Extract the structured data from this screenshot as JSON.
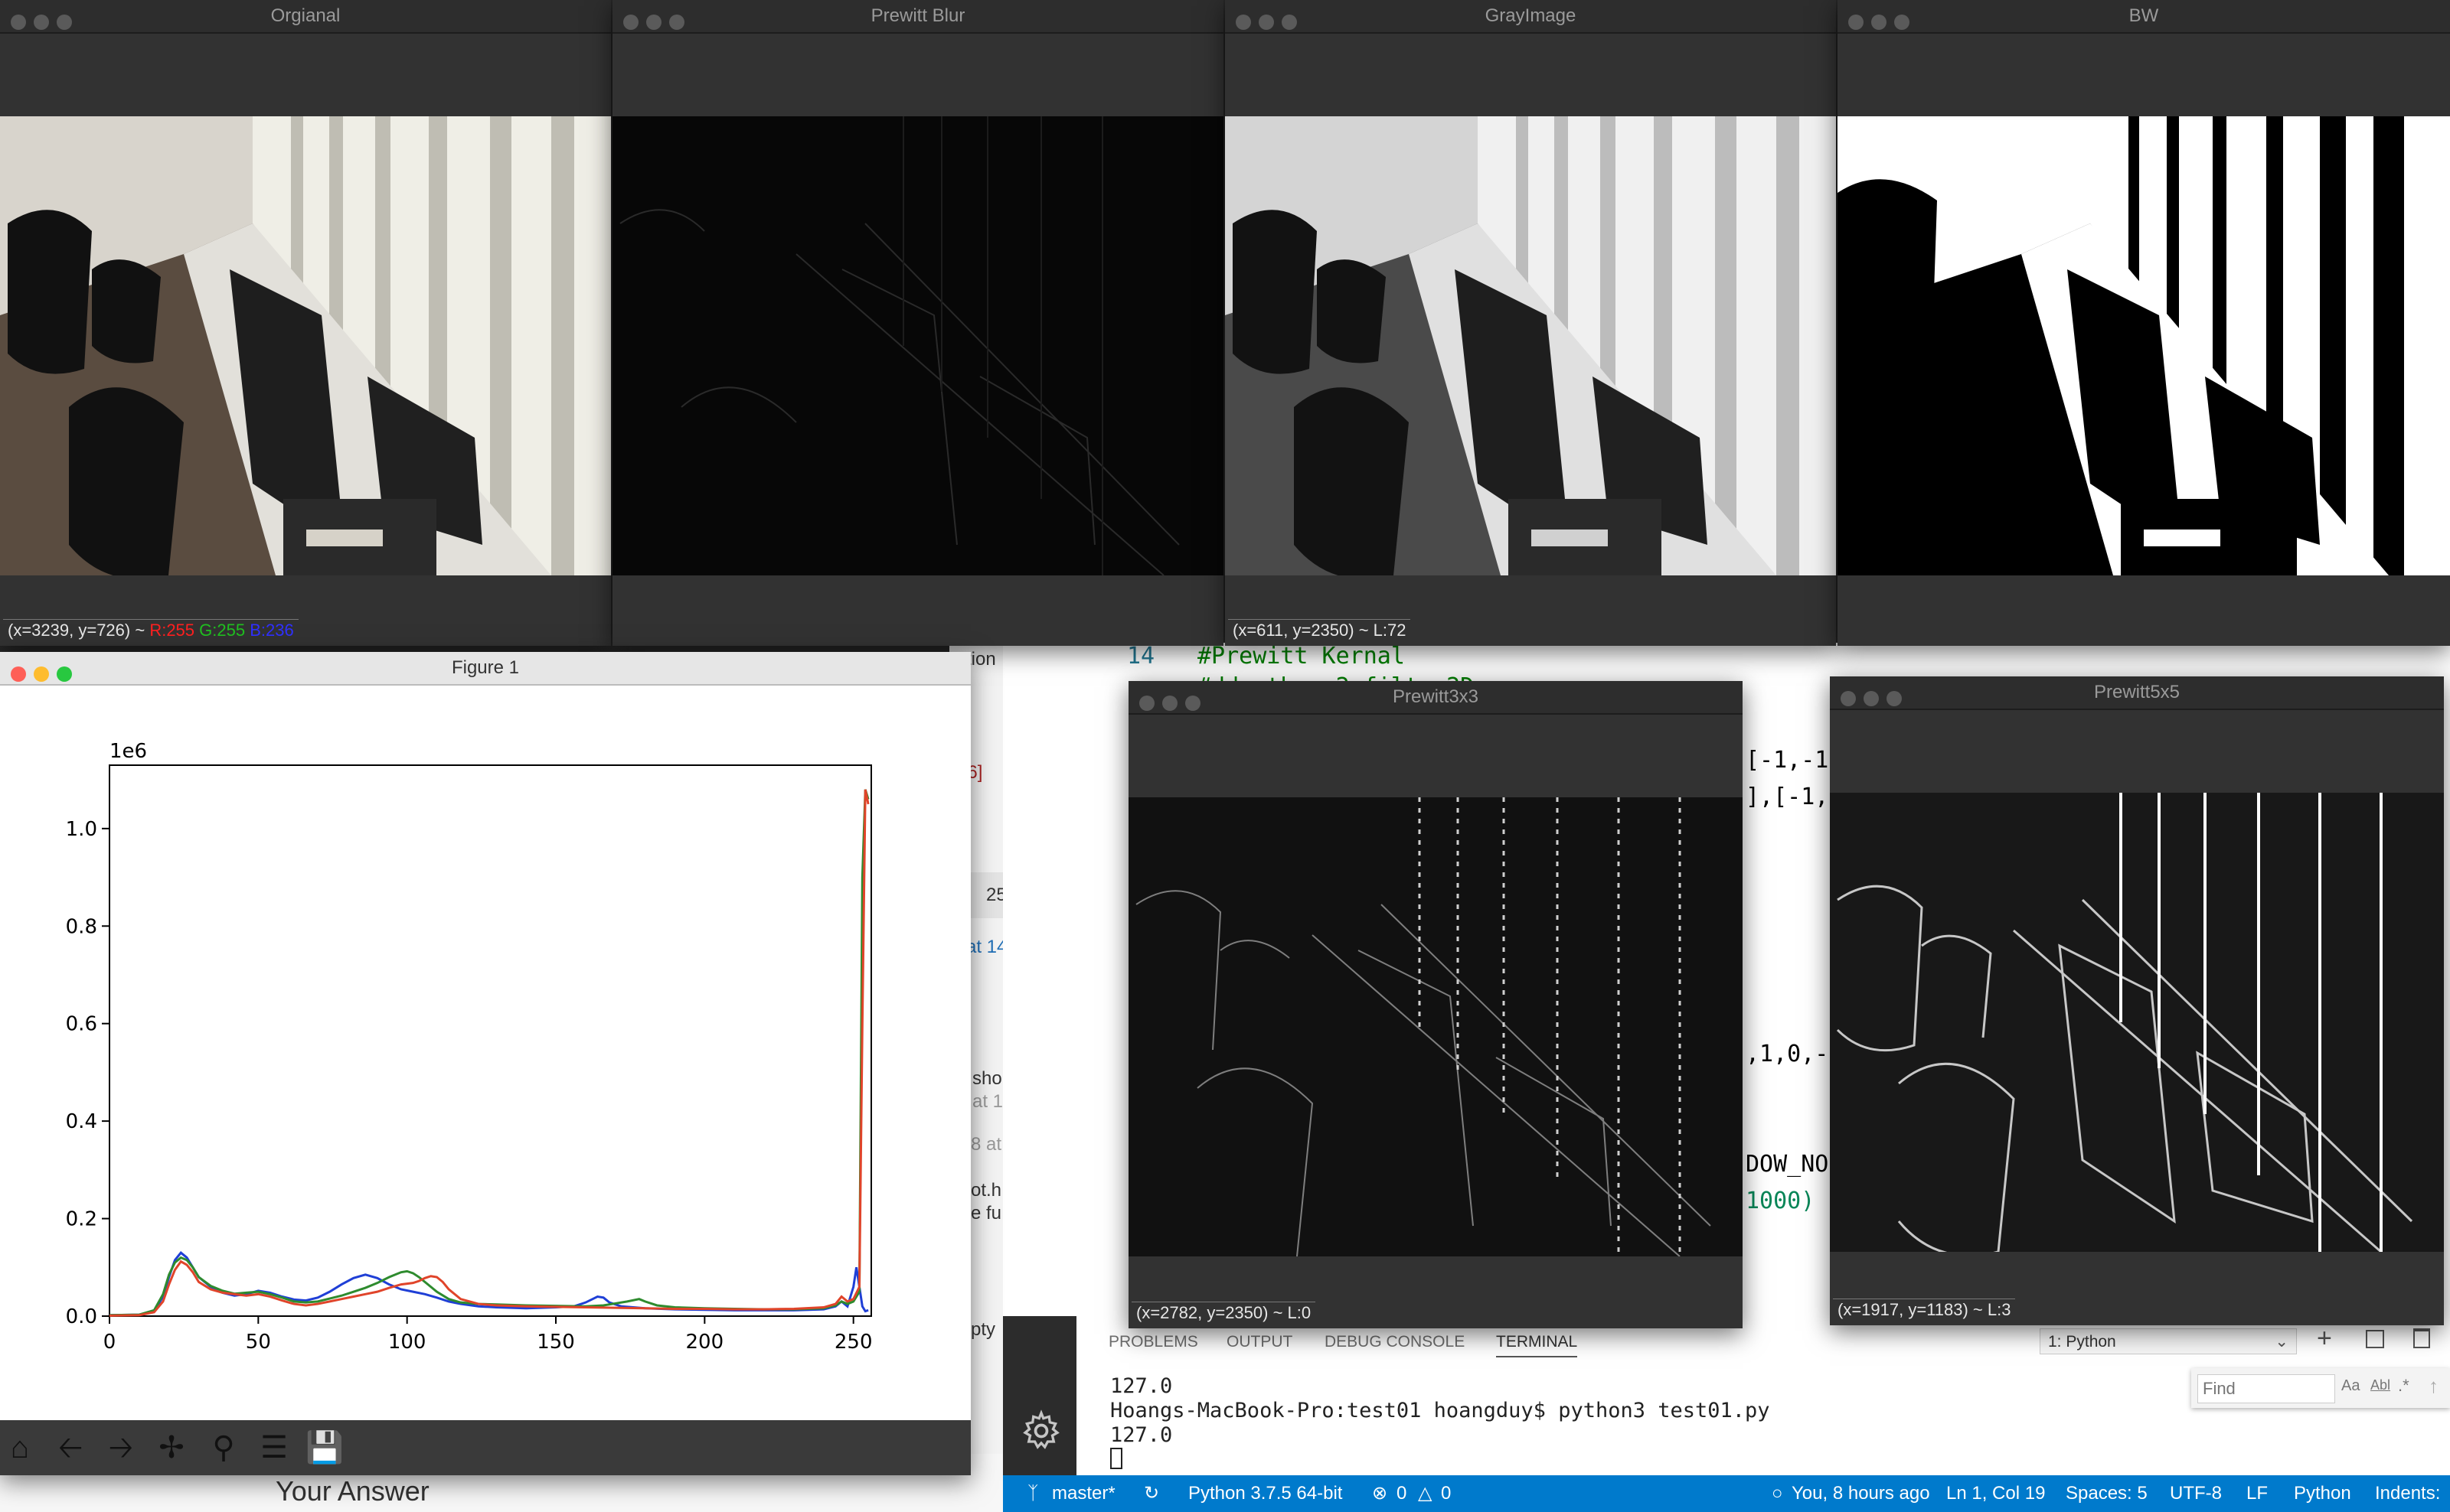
{
  "windows": {
    "original": {
      "title": "Orgianal",
      "coord": "(x=3239, y=726) ~",
      "r": "R:255",
      "g": "G:255",
      "b": "B:236"
    },
    "prewitt_blur": {
      "title": "Prewitt Blur"
    },
    "gray": {
      "title": "GrayImage",
      "coord": "(x=611, y=2350) ~ L:72"
    },
    "bw": {
      "title": "BW"
    },
    "prewitt3": {
      "title": "Prewitt3x3",
      "coord": "(x=2782, y=2350) ~ L:0"
    },
    "prewitt5": {
      "title": "Prewitt5x5",
      "coord": "(x=1917, y=1183) ~ L:3"
    }
  },
  "figure": {
    "title": "Figure 1",
    "toolbar": [
      "home-icon",
      "back-icon",
      "forward-icon",
      "pan-icon",
      "zoom-icon",
      "configure-icon",
      "save-icon"
    ]
  },
  "chart_data": {
    "type": "line",
    "scale_label": "1e6",
    "xlim": [
      0,
      256
    ],
    "ylim": [
      0,
      1.13
    ],
    "xticks": [
      0,
      50,
      100,
      150,
      200,
      250
    ],
    "yticks": [
      "0.0",
      "0.2",
      "0.4",
      "0.6",
      "0.8",
      "1.0"
    ],
    "ytick_values": [
      0,
      0.2,
      0.4,
      0.6,
      0.8,
      1.0
    ],
    "series": [
      {
        "color": "#1f3fd6",
        "x": [
          0,
          10,
          15,
          18,
          20,
          22,
          24,
          26,
          28,
          30,
          34,
          38,
          42,
          46,
          50,
          54,
          58,
          62,
          66,
          70,
          74,
          78,
          82,
          86,
          90,
          94,
          98,
          102,
          106,
          110,
          114,
          118,
          124,
          130,
          140,
          150,
          156,
          160,
          164,
          166,
          168,
          172,
          180,
          190,
          200,
          210,
          220,
          230,
          240,
          244,
          246,
          248,
          250,
          251,
          252,
          253,
          254,
          255
        ],
        "y": [
          0.002,
          0.003,
          0.01,
          0.04,
          0.08,
          0.115,
          0.13,
          0.12,
          0.1,
          0.08,
          0.06,
          0.048,
          0.042,
          0.045,
          0.052,
          0.048,
          0.04,
          0.034,
          0.032,
          0.038,
          0.05,
          0.065,
          0.078,
          0.085,
          0.078,
          0.065,
          0.055,
          0.05,
          0.045,
          0.038,
          0.03,
          0.025,
          0.02,
          0.018,
          0.016,
          0.018,
          0.02,
          0.028,
          0.04,
          0.038,
          0.028,
          0.02,
          0.016,
          0.014,
          0.013,
          0.012,
          0.012,
          0.012,
          0.014,
          0.02,
          0.03,
          0.02,
          0.06,
          0.1,
          0.06,
          0.02,
          0.01,
          0.012
        ]
      },
      {
        "color": "#2e8b2e",
        "x": [
          0,
          10,
          15,
          18,
          20,
          22,
          24,
          26,
          28,
          30,
          34,
          38,
          42,
          46,
          50,
          54,
          58,
          62,
          66,
          70,
          74,
          78,
          82,
          86,
          90,
          94,
          98,
          100,
          102,
          104,
          106,
          110,
          114,
          118,
          124,
          130,
          140,
          150,
          160,
          166,
          170,
          174,
          178,
          180,
          184,
          190,
          200,
          210,
          220,
          230,
          240,
          244,
          246,
          248,
          250,
          252,
          253,
          254,
          255
        ],
        "y": [
          0.002,
          0.003,
          0.012,
          0.045,
          0.085,
          0.11,
          0.12,
          0.115,
          0.1,
          0.08,
          0.062,
          0.052,
          0.046,
          0.048,
          0.05,
          0.045,
          0.038,
          0.03,
          0.028,
          0.03,
          0.036,
          0.042,
          0.05,
          0.058,
          0.068,
          0.08,
          0.09,
          0.092,
          0.088,
          0.08,
          0.07,
          0.05,
          0.035,
          0.028,
          0.025,
          0.024,
          0.022,
          0.021,
          0.02,
          0.022,
          0.026,
          0.03,
          0.035,
          0.03,
          0.022,
          0.018,
          0.016,
          0.015,
          0.014,
          0.014,
          0.016,
          0.022,
          0.03,
          0.025,
          0.03,
          0.05,
          0.9,
          1.08,
          1.06
        ]
      },
      {
        "color": "#e0442a",
        "x": [
          0,
          10,
          15,
          18,
          20,
          22,
          24,
          26,
          28,
          30,
          34,
          38,
          42,
          46,
          50,
          54,
          58,
          62,
          66,
          70,
          74,
          78,
          82,
          86,
          90,
          94,
          98,
          102,
          104,
          106,
          108,
          110,
          112,
          114,
          118,
          124,
          130,
          140,
          150,
          160,
          170,
          180,
          190,
          200,
          210,
          220,
          230,
          240,
          244,
          246,
          248,
          250,
          252,
          253,
          254,
          255
        ],
        "y": [
          0.001,
          0.002,
          0.008,
          0.03,
          0.065,
          0.095,
          0.112,
          0.105,
          0.09,
          0.07,
          0.055,
          0.048,
          0.045,
          0.042,
          0.045,
          0.04,
          0.032,
          0.025,
          0.022,
          0.025,
          0.03,
          0.035,
          0.04,
          0.045,
          0.05,
          0.058,
          0.065,
          0.068,
          0.072,
          0.078,
          0.082,
          0.08,
          0.07,
          0.055,
          0.035,
          0.025,
          0.022,
          0.02,
          0.019,
          0.018,
          0.017,
          0.016,
          0.015,
          0.015,
          0.014,
          0.014,
          0.015,
          0.018,
          0.025,
          0.04,
          0.03,
          0.035,
          0.06,
          0.6,
          1.08,
          1.05
        ]
      }
    ]
  },
  "editor": {
    "line_number": "14",
    "comment": "#Prewitt Kernal",
    "hidden_line": "#ddepth cv2.filter2D",
    "frag1_a": "[-1,-1",
    "frag2_a": "],[-1,",
    "frag3": ",1,0,-",
    "frag4": "DOW_NO",
    "frag5": "1000)"
  },
  "panel": {
    "tabs": [
      "PROBLEMS",
      "OUTPUT",
      "DEBUG CONSOLE",
      "TERMINAL"
    ],
    "terminal_select": "1: Python",
    "find_placeholder": "Find",
    "find_opts": [
      "Aa",
      "Abl",
      ".*"
    ],
    "terminal_lines": [
      "127.0",
      "Hoangs-MacBook-Pro:test01 hoangduy$ python3 test01.py",
      "127.0",
      ""
    ]
  },
  "statusbar": {
    "branch": "master*",
    "python": "Python 3.7.5 64-bit",
    "errors": "0",
    "warnings": "0",
    "blame": "You, 8 hours ago",
    "position": "Ln 1, Col 19",
    "spaces": "Spaces: 5",
    "encoding": "UTF-8",
    "eol": "LF",
    "language": "Python",
    "indents": "Indents:"
  },
  "background": {
    "answer_heading": "Your Answer",
    "frag_ction": "ction",
    "frag_56": "56]",
    "frag_25": "25",
    "frag_at14": "at 14",
    "frag_sho": "sho",
    "frag_at1": "at 1",
    "frag_8at": "8 at",
    "frag_oth": "ot.h",
    "frag_efu": "e fu",
    "frag_pty": "pty"
  }
}
